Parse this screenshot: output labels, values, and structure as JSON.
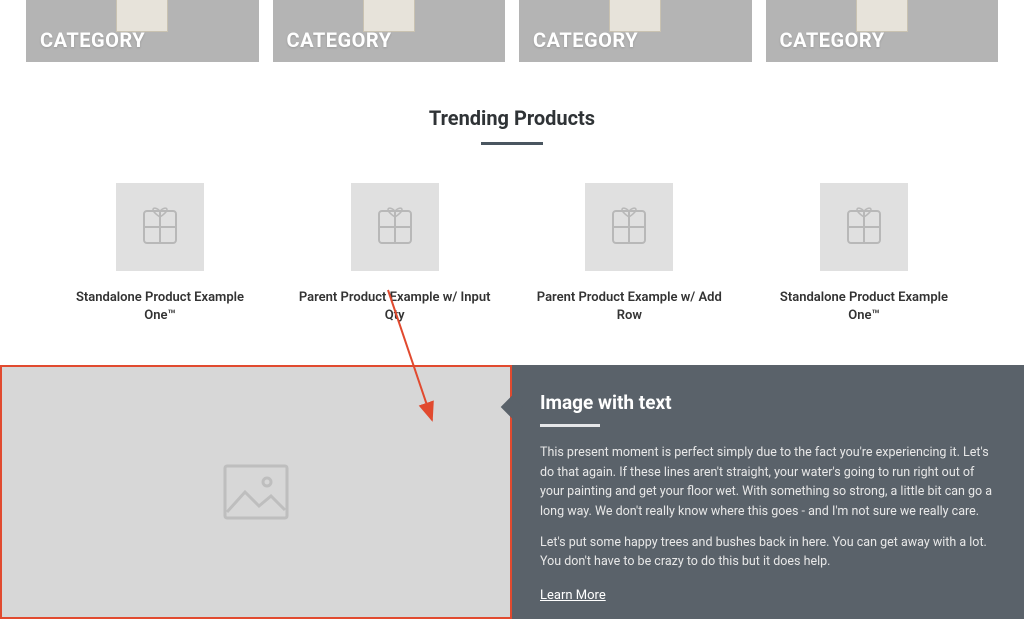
{
  "categories": [
    {
      "label": "CATEGORY"
    },
    {
      "label": "CATEGORY"
    },
    {
      "label": "CATEGORY"
    },
    {
      "label": "CATEGORY"
    }
  ],
  "trending": {
    "heading": "Trending Products",
    "products": [
      {
        "name": "Standalone Product Example One™"
      },
      {
        "name": "Parent Product Example w/ Input Qty"
      },
      {
        "name": "Parent Product Example w/ Add Row"
      },
      {
        "name": "Standalone Product Example One™"
      }
    ]
  },
  "iwt": {
    "heading": "Image with text",
    "para1": "This present moment is perfect simply due to the fact you're experiencing it. Let's do that again. If these lines aren't straight, your water's going to run right out of your painting and get your floor wet. With something so strong, a little bit can go a long way. We don't really know where this goes - and I'm not sure we really care.",
    "para2": "Let's put some happy trees and bushes back in here. You can get away with a lot. You don't have to be crazy to do this but it does help.",
    "link": "Learn More"
  }
}
